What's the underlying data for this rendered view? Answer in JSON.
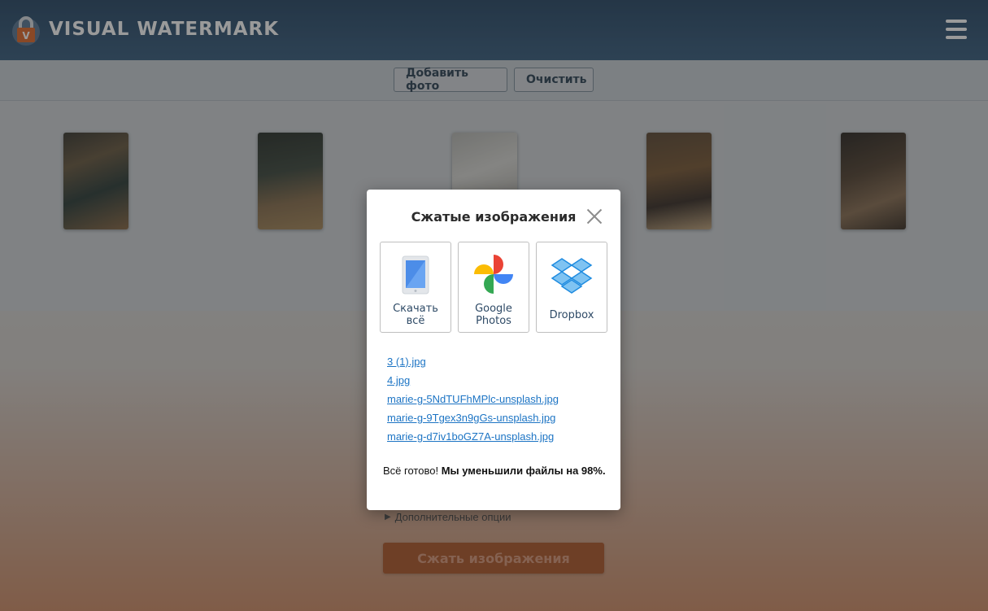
{
  "app": {
    "title": "VISUAL WATERMARK",
    "logo_letter": "V",
    "brand_color": "#2a4a68",
    "accent_color": "#e06a2c"
  },
  "toolbar": {
    "add_photo_label": "Добавить фото",
    "clear_label": "Очистить"
  },
  "thumbnails": [
    {
      "name": "thumbnail-1"
    },
    {
      "name": "thumbnail-2"
    },
    {
      "name": "thumbnail-3"
    },
    {
      "name": "thumbnail-4"
    },
    {
      "name": "thumbnail-5"
    }
  ],
  "page": {
    "more_options_label": "Дополнительные опции",
    "compress_button_label": "Сжать изображения"
  },
  "modal": {
    "title": "Сжатые изображения",
    "services": [
      {
        "icon": "tablet-icon",
        "label_line1": "Скачать",
        "label_line2": "всё"
      },
      {
        "icon": "google-photos-icon",
        "label_line1": "Google",
        "label_line2": "Photos"
      },
      {
        "icon": "dropbox-icon",
        "label_line1": "Dropbox",
        "label_line2": ""
      }
    ],
    "files": [
      "3 (1).jpg",
      "4.jpg",
      "marie-g-5NdTUFhMPlc-unsplash.jpg",
      "marie-g-9Tgex3n9gGs-unsplash.jpg",
      "marie-g-d7iv1boGZ7A-unsplash.jpg"
    ],
    "result_prefix": "Всё готово!",
    "result_bold": "Мы уменьшили файлы на 98%."
  },
  "icons": {
    "menu": "hamburger-menu-icon",
    "close": "close-icon",
    "logo": "padlock-logo-icon",
    "expand": "triangle-right-icon"
  }
}
